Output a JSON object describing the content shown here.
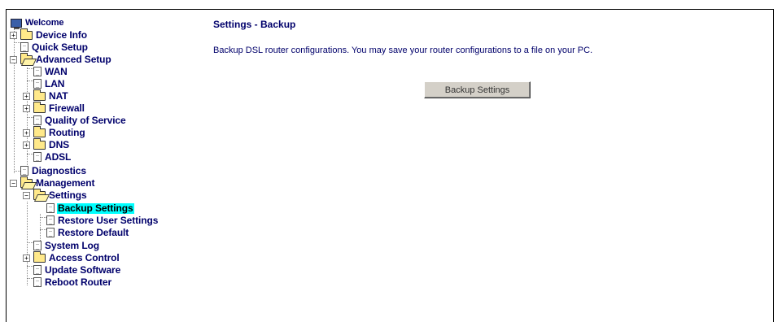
{
  "tree": {
    "welcome": "Welcome",
    "device_info": "Device Info",
    "quick_setup": "Quick Setup",
    "advanced_setup": "Advanced Setup",
    "wan": "WAN",
    "lan": "LAN",
    "nat": "NAT",
    "firewall": "Firewall",
    "qos": "Quality of Service",
    "routing": "Routing",
    "dns": "DNS",
    "adsl": "ADSL",
    "diagnostics": "Diagnostics",
    "management": "Management",
    "settings": "Settings",
    "backup_settings": "Backup Settings",
    "restore_user_settings": "Restore User Settings",
    "restore_default": "Restore Default",
    "system_log": "System Log",
    "access_control": "Access Control",
    "update_software": "Update Software",
    "reboot_router": "Reboot Router",
    "collapsed_sign": "+",
    "expanded_sign": "−"
  },
  "main": {
    "title": "Settings - Backup",
    "description": "Backup DSL router configurations. You may save your router configurations to a file on your PC.",
    "button_label": "Backup Settings"
  },
  "icons": {
    "root": "monitor-icon",
    "folder": "folder-icon",
    "page": "page-icon"
  },
  "colors": {
    "text": "#00006b",
    "selected_highlight": "#00ffff",
    "button_face": "#d4d0c8"
  }
}
